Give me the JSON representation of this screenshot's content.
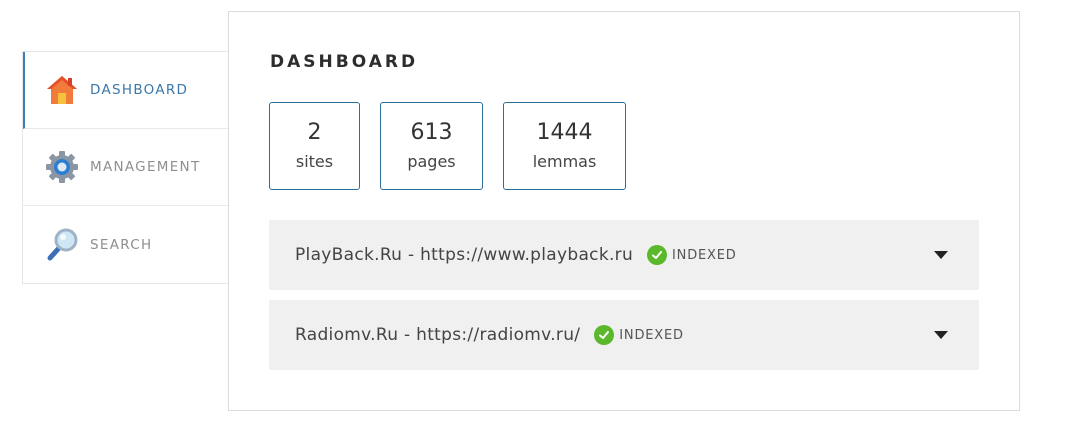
{
  "sidebar": {
    "items": [
      {
        "label": "DASHBOARD",
        "icon": "home-icon",
        "active": true
      },
      {
        "label": "MANAGEMENT",
        "icon": "gear-icon",
        "active": false
      },
      {
        "label": "SEARCH",
        "icon": "magnifier-icon",
        "active": false
      }
    ]
  },
  "main": {
    "title": "DASHBOARD",
    "stats": [
      {
        "value": "2",
        "label": "sites"
      },
      {
        "value": "613",
        "label": "pages"
      },
      {
        "value": "1444",
        "label": "lemmas"
      }
    ],
    "sites": [
      {
        "name": "PlayBack.Ru - https://www.playback.ru",
        "status": "INDEXED"
      },
      {
        "name": "Radiomv.Ru - https://radiomv.ru/",
        "status": "INDEXED"
      }
    ]
  },
  "colors": {
    "accent": "#3a78ab",
    "stat_border": "#2e6f9a",
    "status_ok": "#5bb82a",
    "row_bg": "#f0f0f0"
  }
}
